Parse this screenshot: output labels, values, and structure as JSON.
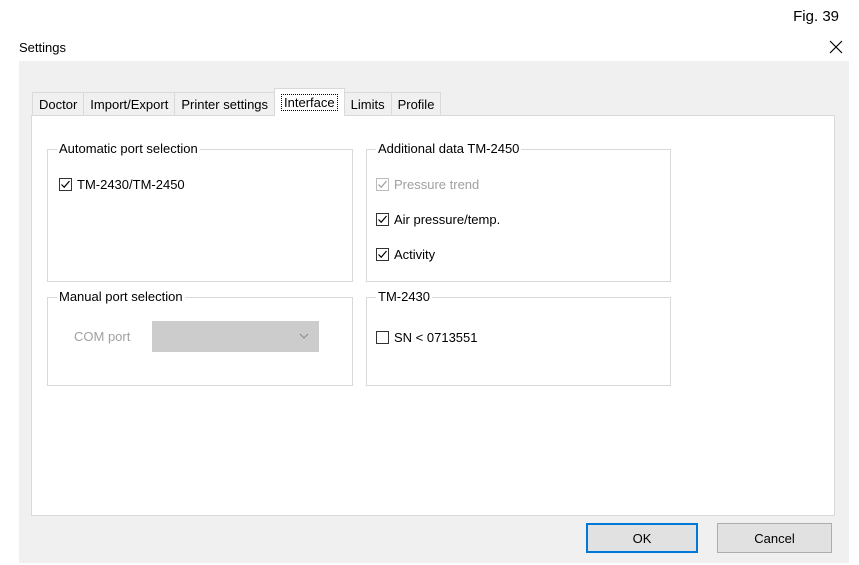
{
  "figure_label": "Fig. 39",
  "window": {
    "title": "Settings",
    "close_icon": "close-icon"
  },
  "tabs": [
    {
      "label": "Doctor",
      "active": false
    },
    {
      "label": "Import/Export",
      "active": false
    },
    {
      "label": "Printer settings",
      "active": false
    },
    {
      "label": "Interface",
      "active": true
    },
    {
      "label": "Limits",
      "active": false
    },
    {
      "label": "Profile",
      "active": false
    }
  ],
  "automatic_port": {
    "title": "Automatic port selection",
    "checkbox": {
      "label": "TM-2430/TM-2450",
      "checked": true,
      "enabled": true
    }
  },
  "manual_port": {
    "title": "Manual port selection",
    "com_label": "COM port",
    "com_value": "",
    "enabled": false
  },
  "additional_data": {
    "title": "Additional data TM-2450",
    "items": [
      {
        "label": "Pressure trend",
        "checked": true,
        "enabled": false
      },
      {
        "label": "Air pressure/temp.",
        "checked": true,
        "enabled": true
      },
      {
        "label": "Activity",
        "checked": true,
        "enabled": true
      }
    ]
  },
  "tm2430": {
    "title": "TM-2430",
    "checkbox": {
      "label": "SN < 0713551",
      "checked": false,
      "enabled": true
    }
  },
  "buttons": {
    "ok": "OK",
    "cancel": "Cancel"
  }
}
